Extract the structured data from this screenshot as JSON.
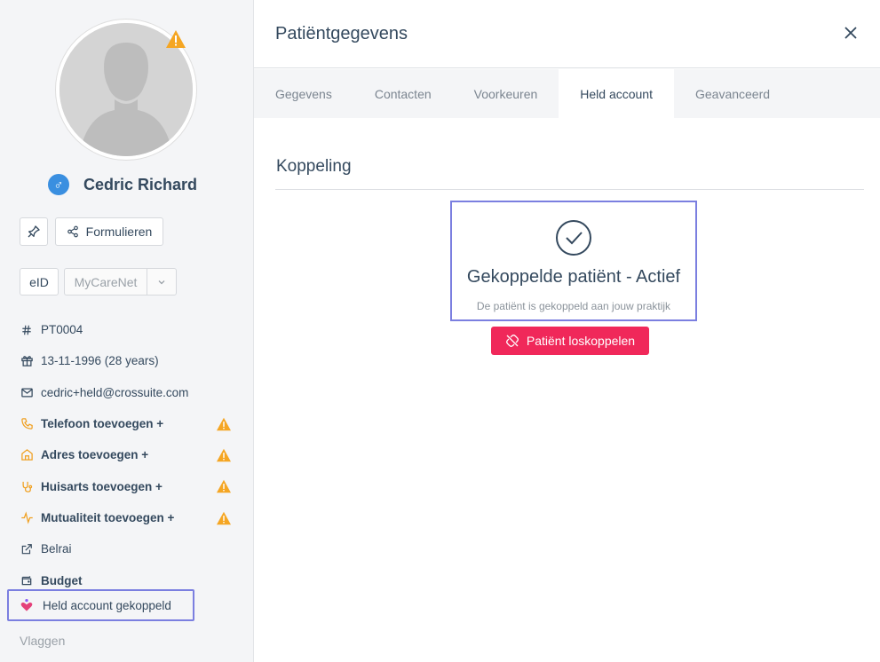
{
  "sidebar": {
    "patient_name": "Cedric Richard",
    "gender_symbol": "♂",
    "forms_label": "Formulieren",
    "eid_label": "eID",
    "mycarenet_label": "MyCareNet",
    "info": [
      {
        "icon": "hash-icon",
        "text": "PT0004"
      },
      {
        "icon": "gift-icon",
        "text": "13-11-1996 (28 years)"
      },
      {
        "icon": "mail-icon",
        "text": "cedric+held@crossuite.com"
      },
      {
        "icon": "phone-icon",
        "text": "Telefoon toevoegen +",
        "warning": true
      },
      {
        "icon": "home-icon",
        "text": "Adres toevoegen +",
        "warning": true
      },
      {
        "icon": "stethoscope-icon",
        "text": "Huisarts toevoegen +",
        "warning": true
      },
      {
        "icon": "activity-icon",
        "text": "Mutualiteit toevoegen +",
        "warning": true
      },
      {
        "icon": "external-link-icon",
        "text": "Belrai"
      },
      {
        "icon": "wallet-icon",
        "text": "Budget"
      }
    ],
    "held_label": "Held account gekoppeld",
    "flags_label": "Vlaggen"
  },
  "header": {
    "title": "Patiëntgegevens"
  },
  "tabs": [
    {
      "label": "Gegevens"
    },
    {
      "label": "Contacten"
    },
    {
      "label": "Voorkeuren"
    },
    {
      "label": "Held account",
      "active": true
    },
    {
      "label": "Geavanceerd"
    }
  ],
  "main": {
    "section_title": "Koppeling",
    "status_title": "Gekoppelde patiënt - Actief",
    "status_subtitle": "De patiënt is gekoppeld aan jouw praktijk",
    "unlink_label": "Patiënt loskoppelen"
  },
  "colors": {
    "warning": "#f5a623",
    "accent_orange": "#f0a020",
    "danger": "#f0285a",
    "highlight": "#7b7fe0",
    "gender": "#3a8fe0"
  }
}
